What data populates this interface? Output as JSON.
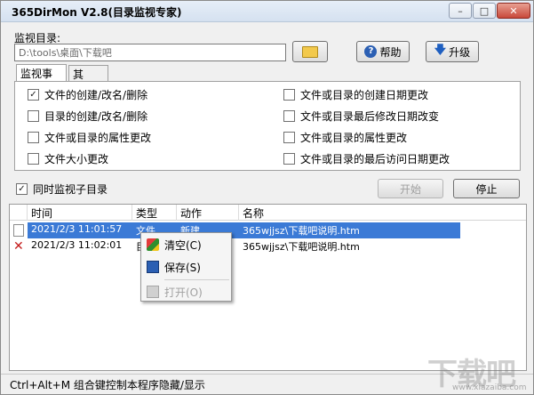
{
  "window": {
    "title": "365DirMon V2.8(目录监视专家)",
    "min_glyph": "–",
    "max_glyph": "□",
    "close_glyph": "✕"
  },
  "dir": {
    "label": "监视目录:",
    "value": "D:\\tools\\桌面\\下载吧"
  },
  "buttons": {
    "help": "帮助",
    "upgrade": "升级",
    "start": "开始",
    "stop": "停止"
  },
  "tabs": [
    {
      "label": "监视事件",
      "active": true
    },
    {
      "label": "其他...",
      "active": false
    }
  ],
  "events": [
    {
      "label": "文件的创建/改名/删除",
      "checked": true
    },
    {
      "label": "目录的创建/改名/删除",
      "checked": false
    },
    {
      "label": "文件或目录的属性更改",
      "checked": false
    },
    {
      "label": "文件大小更改",
      "checked": false
    },
    {
      "label": "文件或目录的创建日期更改",
      "checked": false
    },
    {
      "label": "文件或目录最后修改日期改变",
      "checked": false
    },
    {
      "label": "文件或目录的属性更改",
      "checked": false
    },
    {
      "label": "文件或目录的最后访问日期更改",
      "checked": false
    }
  ],
  "subdir": {
    "label": "同时监视子目录",
    "checked": true
  },
  "list": {
    "columns": [
      "时间",
      "类型",
      "动作",
      "名称"
    ],
    "rows": [
      {
        "time": "2021/2/3 11:01:57",
        "type": "文件",
        "action": "新建",
        "name": "365wjjsz\\下载吧说明.htm",
        "icon": "document-icon",
        "selected": true
      },
      {
        "time": "2021/2/3 11:02:01",
        "type": "目",
        "action": "",
        "name": "365wjjsz\\下载吧说明.htm",
        "icon": "delete-x-icon",
        "selected": false
      }
    ]
  },
  "context_menu": {
    "items": [
      {
        "label": "清空(C)",
        "icon": "brush-icon",
        "disabled": false
      },
      {
        "label": "保存(S)",
        "icon": "save-icon",
        "disabled": false
      },
      {
        "label": "打开(O)",
        "icon": "open-folder-icon",
        "disabled": true
      }
    ]
  },
  "status": {
    "text": "Ctrl+Alt+M 组合键控制本程序隐藏/显示"
  },
  "watermark": {
    "text": "下载吧",
    "sub": "www.xiazaiba.com"
  }
}
